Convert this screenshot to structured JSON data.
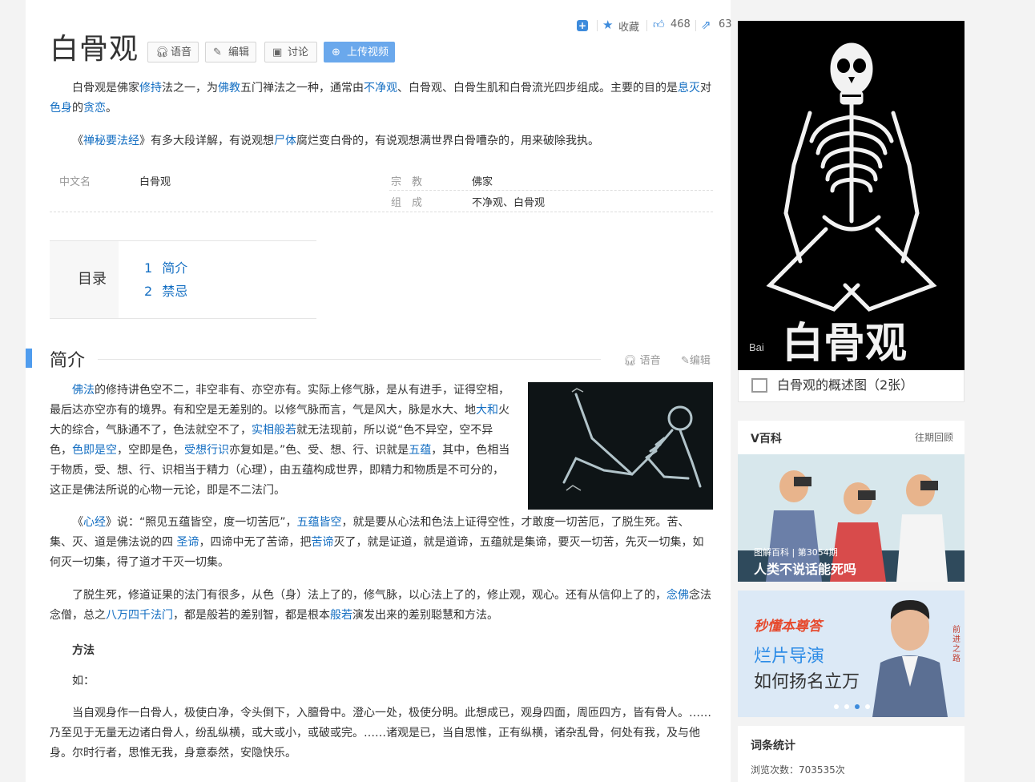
{
  "stats": {
    "add_icon": "+",
    "favorite": "收藏",
    "likes": "468",
    "shares": "63"
  },
  "title": "白骨观",
  "buttons": {
    "voice": "语音",
    "edit": "编辑",
    "discuss": "讨论",
    "upload": "上传视频"
  },
  "intro": {
    "p1": [
      "白骨观是佛家",
      "修持",
      "法之一，为",
      "佛教",
      "五门禅法之一种，通常由",
      "不净观",
      "、白骨观、白骨生肌和白骨流光四步组成。主要的目的是",
      "息灭",
      "对",
      "色身",
      "的",
      "贪恋",
      "。"
    ],
    "p2": [
      "《",
      "禅秘要法经",
      "》有多大段详解，有说观想",
      "尸体",
      "腐烂变白骨的，有说观想满世界白骨嘈杂的，用来破除我执。"
    ]
  },
  "basic_info": {
    "k1": "中文名",
    "v1": "白骨观",
    "k2": "宗　教",
    "v2": "佛家",
    "k3": "组　成",
    "v3": "不净观、白骨观"
  },
  "toc": {
    "label": "目录",
    "items": [
      {
        "num": "1",
        "text": "简介"
      },
      {
        "num": "2",
        "text": "禁忌"
      }
    ]
  },
  "section": {
    "title": "简介",
    "voice": "语音",
    "edit": "编辑"
  },
  "body": {
    "p1": [
      "佛法",
      "的修持讲色空不二，非空非有、亦空亦有。实际上修气脉，是从有进手，证得空相，最后达亦空亦有的境界。有和空是无差别的。以修气脉而言，气是风大，脉是水大、地",
      "大和",
      "火大的综合，气脉通不了，色法就空不了，",
      "实相般若",
      "就无法现前，所以说“色不异空，空不异色，",
      "色即是空",
      "，空即是色，",
      "受想行识",
      "亦复如是。”色、受、想、行、识就是",
      "五蕴",
      "，其中，色相当于物质，受、想、行、识相当于精力（心理），由五蕴构成世界，即精力和物质是不可分的，这正是佛法所说的心物一元论，即是不二法门。"
    ],
    "p2": [
      "《",
      "心经",
      "》说：“照见五蕴皆空，度一切苦厄”，",
      "五蕴皆空",
      "，就是要从心法和色法上证得空性，才敢度一切苦厄，了脱生死。苦、集、灭、道是佛法说的四 ",
      "圣谛",
      "，四谛中无了苦谛，把",
      "苦谛",
      "灭了，就是证道，就是道谛，五蕴就是集谛，要灭一切苦，先灭一切集，如何灭一切集，得了道才干灭一切集。"
    ],
    "p3": [
      "了脱生死，修道证果的法门有很多，从色（身）法上了的，修气脉，以心法上了的，修止观，观心。还有从信仰上了的，",
      "念佛",
      "念法念僧，总之",
      "八万四千法门",
      "，都是般若的差别智，都是根本",
      "般若",
      "演发出来的差别聪慧和方法。"
    ],
    "method": "方法",
    "ru": "如：",
    "p4": "当自观身作一白骨人，极使白净，令头倒下，入膻骨中。澄心一处，极使分明。此想成已，观身四面，周匝四方，皆有骨人。……乃至见于无量无边诸白骨人，纷乱纵横，或大或小，或破或完。……诸观是已，当自思惟，正有纵横，诸杂乱骨，何处有我，及与他身。尔时行者，思惟无我，身意泰然，安隐快乐。"
  },
  "hero": {
    "watermark": "Bai",
    "art_text": "白骨观",
    "caption": "白骨观的概述图（2张）"
  },
  "vbaike": {
    "title": "V百科",
    "more": "往期回顾",
    "tag": "图解百科 | 第3054期",
    "headline": "人类不说话能死吗"
  },
  "ad": {
    "brand": "秒懂本尊答",
    "line1": "烂片导演",
    "line2": "如何扬名立万",
    "side": "前进之路"
  },
  "stat_box": {
    "title": "词条统计",
    "views": "浏览次数：703535次"
  },
  "colors": {
    "link": "#136ec2",
    "accent": "#4f9cee"
  }
}
